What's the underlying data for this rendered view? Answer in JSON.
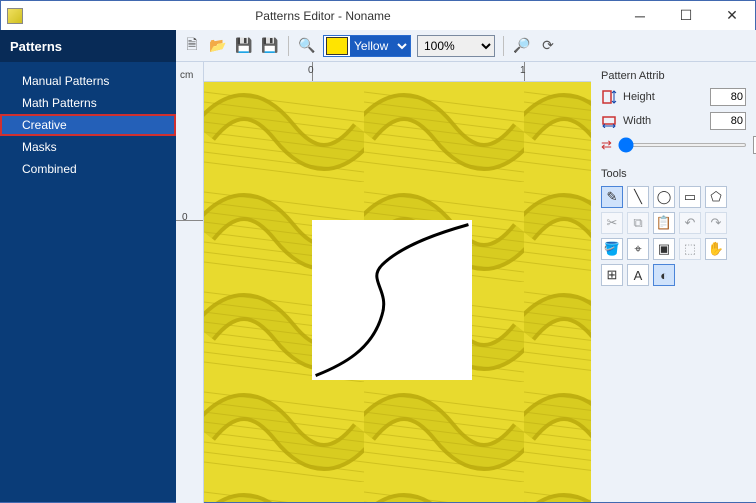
{
  "window": {
    "title": "Patterns Editor - Noname"
  },
  "sidebar": {
    "header": "Patterns",
    "items": [
      {
        "label": "Manual Patterns",
        "selected": false
      },
      {
        "label": "Math Patterns",
        "selected": false
      },
      {
        "label": "Creative",
        "selected": true
      },
      {
        "label": "Masks",
        "selected": false
      },
      {
        "label": "Combined",
        "selected": false
      }
    ]
  },
  "toolbar": {
    "color_label": "Yellow",
    "color_value": "#ffe400",
    "zoom": "100%"
  },
  "ruler": {
    "units": "cm",
    "h_ticks": [
      {
        "pos": 108,
        "label": "0"
      },
      {
        "pos": 320,
        "label": "1"
      }
    ],
    "v_ticks": [
      {
        "pos": 150,
        "label": "0"
      }
    ]
  },
  "attributes": {
    "section_title": "Pattern Attrib",
    "height_label": "Height",
    "height_value": "80",
    "width_label": "Width",
    "width_value": "80",
    "offset_value": "0"
  },
  "tools": {
    "section_title": "Tools"
  }
}
